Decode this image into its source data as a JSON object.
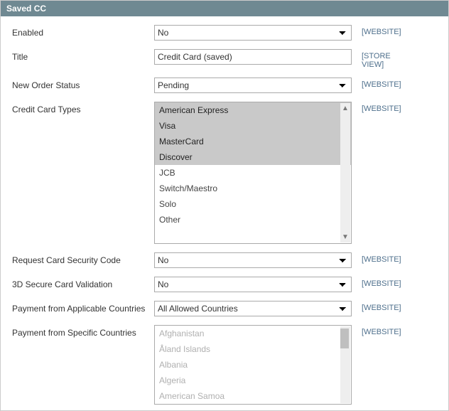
{
  "header": {
    "title": "Saved CC"
  },
  "scope_labels": {
    "website": "[WEBSITE]",
    "store_view": "[STORE VIEW]"
  },
  "fields": {
    "enabled": {
      "label": "Enabled",
      "value": "No"
    },
    "title": {
      "label": "Title",
      "value": "Credit Card (saved)"
    },
    "new_order_status": {
      "label": "New Order Status",
      "value": "Pending"
    },
    "cc_types": {
      "label": "Credit Card Types",
      "options": [
        {
          "text": "American Express",
          "selected": true
        },
        {
          "text": "Visa",
          "selected": true
        },
        {
          "text": "MasterCard",
          "selected": true
        },
        {
          "text": "Discover",
          "selected": true
        },
        {
          "text": "JCB",
          "selected": false
        },
        {
          "text": "Switch/Maestro",
          "selected": false
        },
        {
          "text": "Solo",
          "selected": false
        },
        {
          "text": "Other",
          "selected": false
        }
      ]
    },
    "request_csc": {
      "label": "Request Card Security Code",
      "value": "No"
    },
    "secure3d": {
      "label": "3D Secure Card Validation",
      "value": "No"
    },
    "applicable_countries": {
      "label": "Payment from Applicable Countries",
      "value": "All Allowed Countries"
    },
    "specific_countries": {
      "label": "Payment from Specific Countries",
      "options": [
        {
          "text": "Afghanistan",
          "selected": false
        },
        {
          "text": "Åland Islands",
          "selected": false
        },
        {
          "text": "Albania",
          "selected": false
        },
        {
          "text": "Algeria",
          "selected": false
        },
        {
          "text": "American Samoa",
          "selected": false
        }
      ]
    }
  }
}
